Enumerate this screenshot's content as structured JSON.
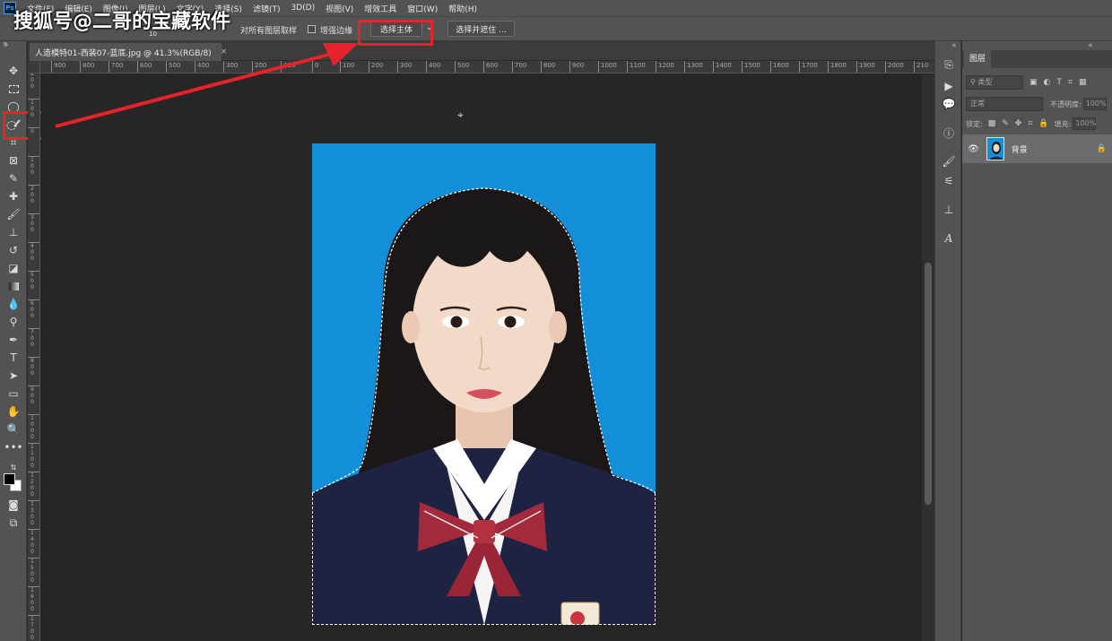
{
  "app": {
    "logo": "Ps"
  },
  "watermark": "搜狐号@二哥的宝藏软件",
  "menu": [
    "文件(F)",
    "编辑(E)",
    "图像(I)",
    "图层(L)",
    "文字(Y)",
    "选择(S)",
    "滤镜(T)",
    "3D(D)",
    "视图(V)",
    "增效工具",
    "窗口(W)",
    "帮助(H)"
  ],
  "options": {
    "brush_size": "10",
    "sample_all_layers": "对所有图层取样",
    "enhance_edge": "增强边缘",
    "select_subject": "选择主体",
    "select_and_mask": "选择并遮住 ..."
  },
  "document_tab": {
    "title": "人造模特01-西装07-蓝底.jpg @ 41.3%(RGB/8)",
    "close": "×"
  },
  "ruler_top": [
    "900",
    "800",
    "700",
    "600",
    "500",
    "400",
    "300",
    "200",
    "100",
    "0",
    "100",
    "200",
    "300",
    "400",
    "500",
    "600",
    "700",
    "800",
    "900",
    "1000",
    "1100",
    "1200",
    "1300",
    "1400",
    "1500",
    "1600",
    "1700",
    "1800",
    "1900",
    "2000",
    "210"
  ],
  "ruler_left": [
    "2 0 0",
    "1 0 0",
    "0",
    "1 0 0",
    "2 0 0",
    "3 0 0",
    "4 0 0",
    "5 0 0",
    "6 0 0",
    "7 0 0",
    "8 0 0",
    "9 0 0",
    "1 0 0 0",
    "1 1 0 0",
    "1 2 0 0",
    "1 3 0 0",
    "1 4 0 0",
    "1 5 0 0",
    "1 6 0 0",
    "1 7 0 0"
  ],
  "layers_panel": {
    "tab": "图层",
    "filter_kind": "类型",
    "blend_mode": "正常",
    "opacity_label": "不透明度:",
    "opacity_value": "100%",
    "lock_label": "锁定:",
    "fill_label": "填充:",
    "fill_value": "100%",
    "layer_name": "背景"
  },
  "colors": {
    "accent_red": "#e8222b",
    "photo_background": "#128fd8",
    "ui_panel": "#535353",
    "canvas": "#262626"
  }
}
